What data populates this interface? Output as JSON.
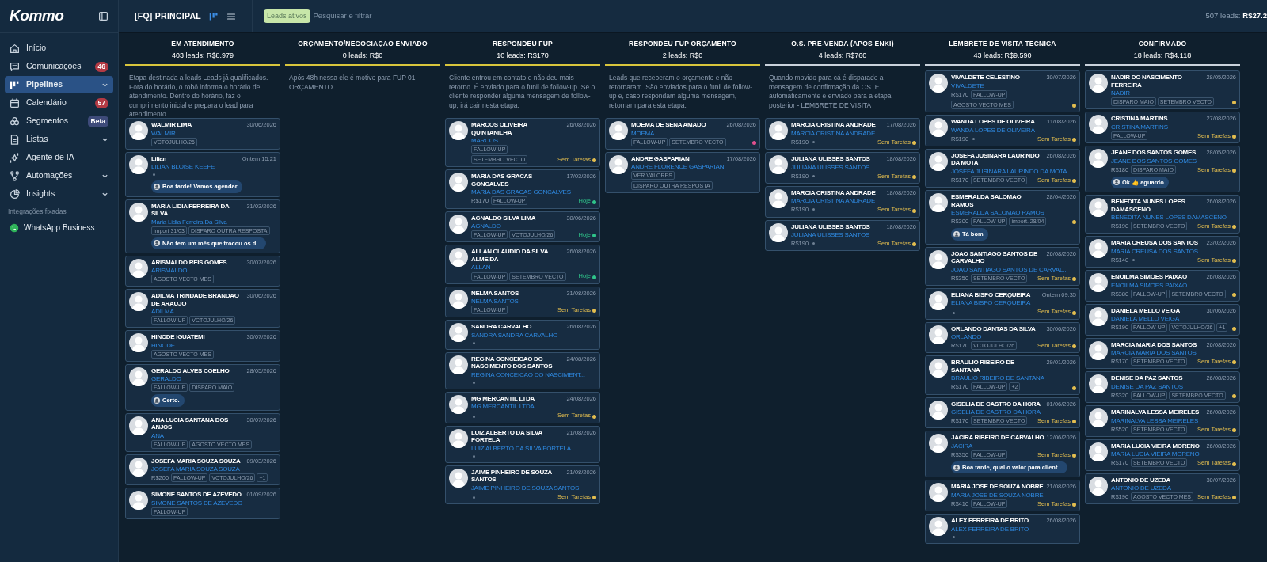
{
  "topbar": {
    "logo": "Kommo",
    "pipeline": "[FQ] PRINCIPAL",
    "filter_chip": "Leads ativos",
    "search": {
      "placeholder": "Pesquisar e filtrar"
    },
    "total_label": "507 leads:",
    "total_value": "R$27.2"
  },
  "sidebar": {
    "items": [
      {
        "label": "Início",
        "selected": false,
        "has_submenu": false
      },
      {
        "label": "Comunicações",
        "selected": false,
        "has_submenu": false,
        "badge": {
          "text": "46",
          "kind": "count"
        }
      },
      {
        "label": "Pipelines",
        "selected": true,
        "has_submenu": true
      },
      {
        "label": "Calendário",
        "selected": false,
        "has_submenu": false,
        "badge": {
          "text": "57",
          "kind": "count"
        }
      },
      {
        "label": "Segmentos",
        "selected": false,
        "has_submenu": false,
        "badge": {
          "text": "Beta",
          "kind": "beta"
        }
      },
      {
        "label": "Listas",
        "selected": false,
        "has_submenu": true
      },
      {
        "label": "Agente de IA",
        "selected": false,
        "has_submenu": false
      },
      {
        "label": "Automações",
        "selected": false,
        "has_submenu": true
      },
      {
        "label": "Insights",
        "selected": false,
        "has_submenu": true
      }
    ],
    "section_label": "Integrações fixadas",
    "pinned": [
      {
        "label": "WhatsApp Business"
      }
    ]
  },
  "columns": [
    {
      "title": "EM ATENDIMENTO",
      "summary": "403 leads: R$8.979",
      "color": "#d8c53c",
      "description": "Etapa destinada a leads Leads já qualificados. Fora do horário, o robô informa o horário de atendimento. Dentro do horário, faz o cumprimento inicial e prepara o lead para atendimento...",
      "cards": [
        {
          "name": "WALMIR LIMA",
          "date": "30/06/2026",
          "contact": "WALMIR",
          "tags": [
            "VCTOJULHO/26"
          ]
        },
        {
          "name": "Lilian",
          "date": "Ontem 15:21",
          "contact": "LILIAN BLOISE KEEFE",
          "message": "Boa tarde! Vamos agendar"
        },
        {
          "name": "MARIA LIDIA FERREIRA DA SILVA",
          "date": "31/03/2026",
          "contact": "Maria Lidia Ferreira Da Silva",
          "tags": [
            "import 31/03",
            "DISPARO OUTRA RESPOSTA"
          ],
          "message": "Não tem um mês que trocou os d..."
        },
        {
          "name": "ARISMALDO REIS GOMES",
          "date": "30/07/2026",
          "contact": "ARISMALDO",
          "tags": [
            "AGOSTO VECTO MES"
          ]
        },
        {
          "name": "ADILMA TRINDADE BRANDAO DE ARAUJO",
          "date": "30/06/2026",
          "contact": "ADILMA",
          "tags": [
            "FALLOW-UP",
            "VCTOJULHO/26"
          ]
        },
        {
          "name": "HINODE IGUATEMI",
          "date": "30/07/2026",
          "contact": "HINODE",
          "tags": [
            "AGOSTO VECTO MES"
          ]
        },
        {
          "name": "GERALDO ALVES COELHO",
          "date": "28/05/2026",
          "contact": "GERALDO",
          "tags": [
            "FALLOW-UP",
            "DISPARO MAIO"
          ],
          "message": "Certo."
        },
        {
          "name": "ANA LUCIA SANTANA DOS ANJOS",
          "date": "30/07/2026",
          "contact": "ANA",
          "tags": [
            "FALLOW-UP",
            "AGOSTO VECTO MES"
          ]
        },
        {
          "name": "JOSEFA MARIA SOUZA SOUZA",
          "date": "09/03/2026",
          "contact": "JOSEFA MARIA SOUZA SOUZA",
          "price": "R$200",
          "tags": [
            "FALLOW-UP",
            "VCTOJULHO/26",
            "+1"
          ]
        },
        {
          "name": "SIMONE SANTOS DE AZEVEDO",
          "date": "01/09/2026",
          "contact": "SIMONE SANTOS DE AZEVEDO",
          "tags": [
            "FALLOW-UP"
          ]
        }
      ]
    },
    {
      "title": "ORÇAMENTO/NEGOCIAÇAO ENVIADO",
      "summary": "0 leads: R$0",
      "color": "#d8c53c",
      "description": "Após 48h nessa ele é motivo para FUP 01 ORÇAMENTO"
    },
    {
      "title": "RESPONDEU FUP",
      "summary": "10 leads: R$170",
      "color": "#d8c53c",
      "description": "Cliente entrou em contato e não deu mais retorno. É enviado para o funil de follow-up. Se o cliente responder alguma mensagem de follow-up, irá cair nesta etapa.",
      "cards": [
        {
          "name": "MARCOS OLIVEIRA QUINTANILHA",
          "date": "26/08/2026",
          "contact": "MARCOS",
          "tags": [
            "FALLOW-UP",
            "SETEMBRO VECTO"
          ],
          "task": {
            "label": "Sem Tarefas",
            "color": "#e2bd4f"
          }
        },
        {
          "name": "MARIA DAS GRACAS GONCALVES",
          "date": "17/03/2026",
          "contact": "MARIA DAS GRACAS GONCALVES",
          "price": "R$170",
          "tags": [
            "FALLOW-UP"
          ],
          "task": {
            "label": "Hoje",
            "color": "#2fc48a"
          }
        },
        {
          "name": "AGNALDO SILVA LIMA",
          "date": "30/06/2026",
          "contact": "AGNALDO",
          "tags": [
            "FALLOW-UP",
            "VCTOJULHO/26"
          ],
          "task": {
            "label": "Hoje",
            "color": "#2fc48a"
          }
        },
        {
          "name": "ALLAN CLAUDIO DA SILVA ALMEIDA",
          "date": "26/08/2026",
          "contact": "ALLAN",
          "tags": [
            "FALLOW-UP",
            "SETEMBRO VECTO"
          ],
          "task": {
            "label": "Hoje",
            "color": "#2fc48a"
          }
        },
        {
          "name": "NELMA SANTOS",
          "date": "31/08/2026",
          "contact": "NELMA SANTOS",
          "tags": [
            "FALLOW-UP"
          ],
          "task": {
            "label": "Sem Tarefas",
            "color": "#e2bd4f"
          }
        },
        {
          "name": "SANDRA CARVALHO",
          "date": "26/08/2026",
          "contact": "SANDRA SANDRA CARVALHO"
        },
        {
          "name": "REGINA CONCEICAO DO NASCIMENTO DOS SANTOS",
          "date": "24/08/2026",
          "contact": "REGINA CONCEICAO DO NASCIMENT..."
        },
        {
          "name": "MG MERCANTIL LTDA",
          "date": "24/08/2026",
          "contact": "MG MERCANTIL LTDA",
          "task": {
            "label": "Sem Tarefas",
            "color": "#e2bd4f"
          }
        },
        {
          "name": "LUIZ ALBERTO DA SILVA PORTELA",
          "date": "21/08/2026",
          "contact": "LUIZ ALBERTO DA SILVA PORTELA"
        },
        {
          "name": "JAIME PINHEIRO DE SOUZA SANTOS",
          "date": "21/08/2026",
          "contact": "JAIME PINHEIRO DE SOUZA SANTOS",
          "task": {
            "label": "Sem Tarefas",
            "color": "#e2bd4f"
          }
        }
      ]
    },
    {
      "title": "RESPONDEU FUP ORÇAMENTO",
      "summary": "2 leads: R$0",
      "color": "#d8c53c",
      "description": "Leads que receberam o orçamento e não retornaram. São enviados para o funil de follow-up e, caso respondam alguma mensagem, retornam para esta etapa.",
      "cards": [
        {
          "name": "MOEMA DE SENA AMADO",
          "date": "26/08/2026",
          "contact": "MOEMA",
          "tags": [
            "FALLOW-UP",
            "SETEMBRO VECTO"
          ],
          "task": {
            "color": "#e0508e"
          }
        },
        {
          "name": "ANDRE GASPARIAN",
          "date": "17/08/2026",
          "contact": "ANDRE FLORENCE GASPARIAN",
          "tags": [
            "VER VALORES",
            "DISPARO OUTRA RESPOSTA"
          ]
        }
      ]
    },
    {
      "title": "O.S. PRÉ-VENDA (APOS ENKI)",
      "summary": "4 leads: R$760",
      "color": "#c9d1da",
      "description": "Quando movido para cá é disparado a mensagem de confirmação da OS. E automaticamente é enviado para a etapa posterior - LEMBRETE DE VISITA",
      "cards": [
        {
          "name": "MARCIA CRISTINA ANDRADE",
          "date": "17/08/2026",
          "contact": "MARCIA CRISTINA ANDRADE",
          "price": "R$190",
          "task": {
            "label": "Sem Tarefas",
            "color": "#e2bd4f"
          }
        },
        {
          "name": "JULIANA ULISSES SANTOS",
          "date": "18/08/2026",
          "contact": "JULIANA ULISSES SANTOS",
          "price": "R$190",
          "task": {
            "label": "Sem Tarefas",
            "color": "#e2bd4f"
          }
        },
        {
          "name": "MARCIA CRISTINA ANDRADE",
          "date": "18/08/2026",
          "contact": "MARCIA CRISTINA ANDRADE",
          "price": "R$190",
          "task": {
            "label": "Sem Tarefas",
            "color": "#e2bd4f"
          }
        },
        {
          "name": "JULIANA ULISSES SANTOS",
          "date": "18/08/2026",
          "contact": "JULIANA ULISSES SANTOS",
          "price": "R$190",
          "task": {
            "label": "Sem Tarefas",
            "color": "#e2bd4f"
          }
        }
      ]
    },
    {
      "title": "LEMBRETE DE VISITA TÉCNICA",
      "summary": "43 leads: R$9.590",
      "color": "#c9d1da",
      "cards": [
        {
          "name": "VIVALDETE CELESTINO",
          "date": "30/07/2026",
          "contact": "VIVALDETE",
          "price": "R$170",
          "tags": [
            "FALLOW-UP",
            "AGOSTO VECTO MES"
          ],
          "task": {
            "color": "#e2bd4f"
          }
        },
        {
          "name": "WANDA LOPES DE OLIVEIRA",
          "date": "11/08/2026",
          "contact": "WANDA LOPES DE OLIVEIRA",
          "price": "R$190",
          "task": {
            "label": "Sem Tarefas",
            "color": "#e2bd4f"
          }
        },
        {
          "name": "JOSEFA JUSINARA LAURINDO DA MOTA",
          "date": "26/08/2026",
          "contact": "JOSEFA JUSINARA LAURINDO DA MOTA",
          "price": "R$170",
          "tags": [
            "SETEMBRO VECTO"
          ],
          "task": {
            "label": "Sem Tarefas",
            "color": "#e2bd4f"
          }
        },
        {
          "name": "ESMERALDA SALOMAO RAMOS",
          "date": "28/04/2026",
          "contact": "ESMERALDA SALOMAO RAMOS",
          "price": "R$300",
          "tags": [
            "FALLOW-UP",
            "import. 28/04"
          ],
          "task": {
            "color": "#e2bd4f"
          },
          "message": "Tá bom"
        },
        {
          "name": "JOAO SANTIAGO SANTOS DE CARVALHO",
          "date": "26/08/2026",
          "contact": "JOAO SANTIAGO SANTOS DE CARVAL...",
          "price": "R$350",
          "tags": [
            "SETEMBRO VECTO"
          ],
          "task": {
            "label": "Sem Tarefas",
            "color": "#e2bd4f"
          }
        },
        {
          "name": "ELIANA BISPO CERQUEIRA",
          "date": "Ontem 09:35",
          "contact": "ELIANA BISPO CERQUEIRA",
          "task": {
            "label": "Sem Tarefas",
            "color": "#e2bd4f"
          }
        },
        {
          "name": "ORLANDO DANTAS DA SILVA",
          "date": "30/06/2026",
          "contact": "ORLANDO",
          "price": "R$170",
          "tags": [
            "VCTOJULHO/26"
          ],
          "task": {
            "label": "Sem Tarefas",
            "color": "#e2bd4f"
          }
        },
        {
          "name": "BRAULIO RIBEIRO DE SANTANA",
          "date": "29/01/2026",
          "contact": "BRAULIO RIBEIRO DE SANTANA",
          "price": "R$170",
          "tags": [
            "FALLOW-UP",
            "+2"
          ],
          "task": {
            "color": "#e2bd4f"
          }
        },
        {
          "name": "GISELIA DE CASTRO DA HORA",
          "date": "01/06/2026",
          "contact": "GISELIA DE CASTRO DA HORA",
          "price": "R$170",
          "tags": [
            "SETEMBRO VECTO"
          ],
          "task": {
            "label": "Sem Tarefas",
            "color": "#e2bd4f"
          }
        },
        {
          "name": "JACIRA RIBEIRO DE CARVALHO",
          "date": "12/06/2026",
          "contact": "JACIRA",
          "price": "R$350",
          "tags": [
            "FALLOW-UP"
          ],
          "task": {
            "label": "Sem Tarefas",
            "color": "#e2bd4f"
          },
          "message": "Boa tarde, qual o valor para client..."
        },
        {
          "name": "MARIA JOSE DE SOUZA NOBRE",
          "date": "21/08/2026",
          "contact": "MARIA JOSE DE SOUZA NOBRE",
          "price": "R$410",
          "tags": [
            "FALLOW-UP"
          ],
          "task": {
            "label": "Sem Tarefas",
            "color": "#e2bd4f"
          }
        },
        {
          "name": "ALEX FERREIRA DE BRITO",
          "date": "26/08/2026",
          "contact": "ALEX FERREIRA DE BRITO"
        }
      ]
    },
    {
      "title": "CONFIRMADO",
      "summary": "18 leads: R$4.118",
      "color": "#c9d1da",
      "cards": [
        {
          "name": "NADIR DO NASCIMENTO FERREIRA",
          "date": "28/05/2026",
          "contact": "NADIR",
          "tags": [
            "DISPARO MAIO",
            "SETEMBRO VECTO"
          ],
          "task": {
            "color": "#e2bd4f"
          }
        },
        {
          "name": "CRISTINA MARTINS",
          "date": "27/08/2026",
          "contact": "CRISTINA MARTINS",
          "tags": [
            "FALLOW-UP"
          ],
          "task": {
            "label": "Sem Tarefas",
            "color": "#e2bd4f"
          }
        },
        {
          "name": "JEANE DOS SANTOS GOMES",
          "date": "28/05/2026",
          "contact": "JEANE DOS SANTOS GOMES",
          "price": "R$180",
          "tags": [
            "DISPARO MAIO"
          ],
          "task": {
            "label": "Sem Tarefas",
            "color": "#e2bd4f"
          },
          "message": "Ok 👍 aguardo"
        },
        {
          "name": "BENEDITA NUNES LOPES DAMASCENO",
          "date": "26/08/2026",
          "contact": "BENEDITA NUNES LOPES DAMASCENO",
          "price": "R$190",
          "tags": [
            "SETEMBRO VECTO"
          ],
          "task": {
            "label": "Sem Tarefas",
            "color": "#e2bd4f"
          }
        },
        {
          "name": "MARIA CREUSA DOS SANTOS",
          "date": "23/02/2026",
          "contact": "MARIA CREUSA DOS SANTOS",
          "price": "R$140",
          "task": {
            "label": "Sem Tarefas",
            "color": "#e2bd4f"
          }
        },
        {
          "name": "ENOILMA SIMOES PAIXAO",
          "date": "26/08/2026",
          "contact": "ENOILMA SIMOES PAIXAO",
          "price": "R$380",
          "tags": [
            "FALLOW-UP",
            "SETEMBRO VECTO"
          ],
          "task": {
            "color": "#e2bd4f"
          }
        },
        {
          "name": "DANIELA MELLO VEIGA",
          "date": "30/06/2026",
          "contact": "DANIELA MELLO VEIGA",
          "price": "R$190",
          "tags": [
            "FALLOW-UP",
            "VCTOJULHO/26",
            "+1"
          ],
          "task": {
            "color": "#e2bd4f"
          }
        },
        {
          "name": "MARCIA MARIA DOS SANTOS",
          "date": "26/08/2026",
          "contact": "MARCIA MARIA DOS SANTOS",
          "price": "R$170",
          "tags": [
            "SETEMBRO VECTO"
          ],
          "task": {
            "label": "Sem Tarefas",
            "color": "#e2bd4f"
          }
        },
        {
          "name": "DENISE DA PAZ SANTOS",
          "date": "26/08/2026",
          "contact": "DENISE DA PAZ SANTOS",
          "price": "R$320",
          "tags": [
            "FALLOW-UP",
            "SETEMBRO VECTO"
          ],
          "task": {
            "color": "#e2bd4f"
          }
        },
        {
          "name": "MARINALVA LESSA MEIRELES",
          "date": "26/08/2026",
          "contact": "MARINALVA LESSA MEIRELES",
          "price": "R$520",
          "tags": [
            "SETEMBRO VECTO"
          ],
          "task": {
            "label": "Sem Tarefas",
            "color": "#e2bd4f"
          }
        },
        {
          "name": "MARIA LUCIA VIEIRA MORENO",
          "date": "26/08/2026",
          "contact": "MARIA LUCIA VIEIRA MORENO",
          "price": "R$170",
          "tags": [
            "SETEMBRO VECTO"
          ],
          "task": {
            "label": "Sem Tarefas",
            "color": "#e2bd4f"
          }
        },
        {
          "name": "ANTONIO DE UZEDA",
          "date": "30/07/2026",
          "contact": "ANTONIO DE UZEDA",
          "price": "R$190",
          "tags": [
            "AGOSTO VECTO MES"
          ],
          "task": {
            "label": "Sem Tarefas",
            "color": "#e2bd4f"
          }
        }
      ]
    }
  ]
}
